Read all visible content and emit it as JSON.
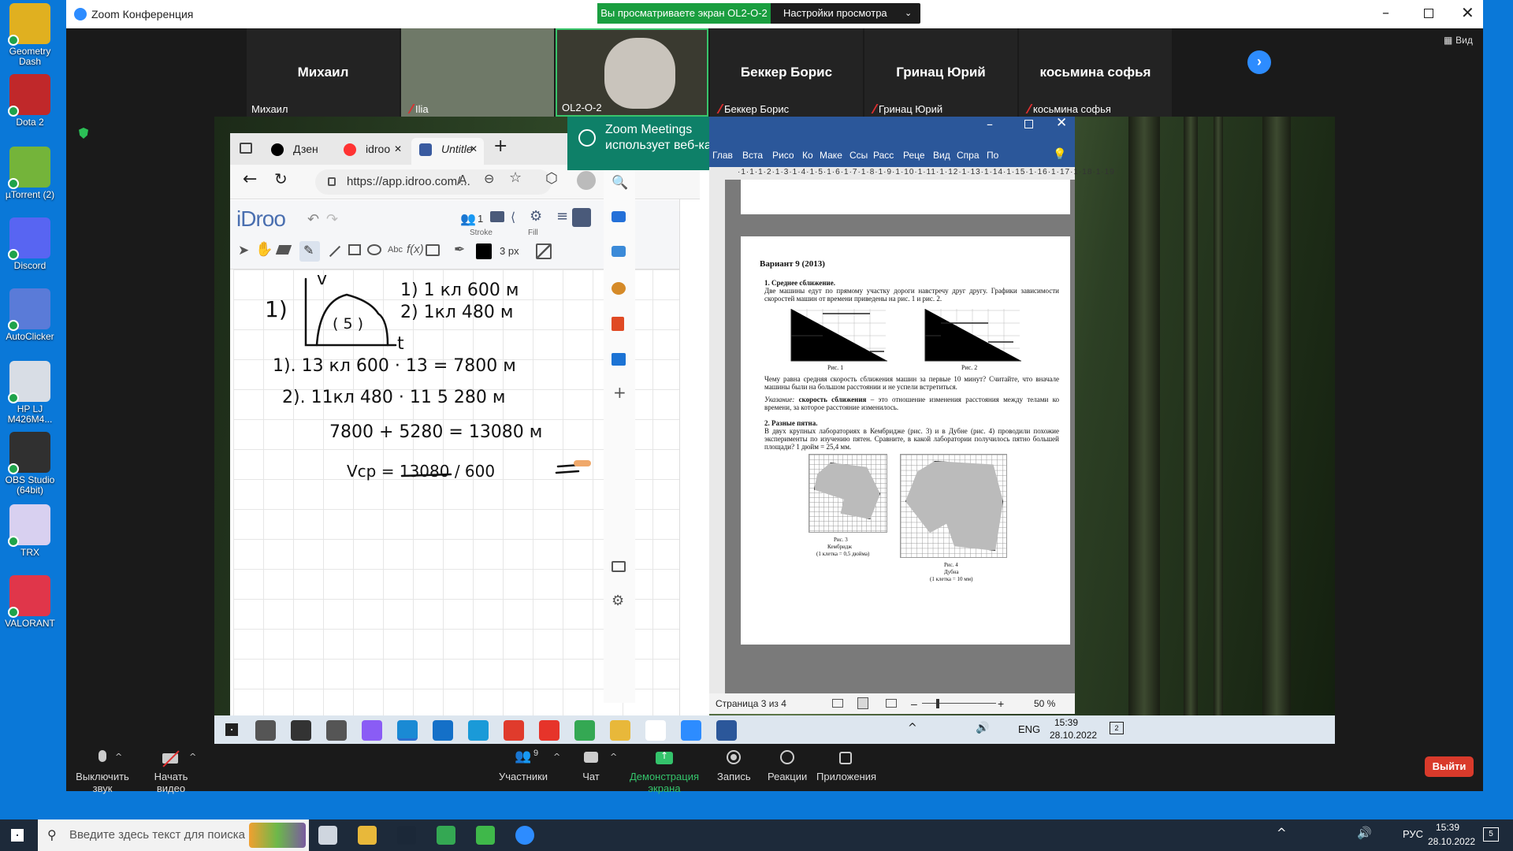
{
  "desktop_icons": [
    {
      "label": "Geometry Dash",
      "icon": "geometry-dash-icon",
      "color": "#e0b020"
    },
    {
      "label": "Dota 2",
      "icon": "dota2-icon",
      "color": "#c0282a"
    },
    {
      "label": "µTorrent (2)",
      "icon": "utorrent-icon",
      "color": "#74b43a"
    },
    {
      "label": "Discord",
      "icon": "discord-icon",
      "color": "#5865f2"
    },
    {
      "label": "AutoClicker",
      "icon": "mouse-icon",
      "color": "#5a7bd8"
    },
    {
      "label": "HP LJ M426M4...",
      "icon": "printer-icon",
      "color": "#d8dde5"
    },
    {
      "label": "OBS Studio (64bit)",
      "icon": "obs-icon",
      "color": "#303030"
    },
    {
      "label": "TRX",
      "icon": "trx-icon",
      "color": "#d8d0f0"
    },
    {
      "label": "VALORANT",
      "icon": "valorant-icon",
      "color": "#e0364a"
    }
  ],
  "zoom": {
    "title": "Zoom Конференция",
    "share_banner": "Вы просматриваете экран OL2-O-2",
    "view_settings": "Настройки просмотра",
    "view_label": "Вид",
    "participants": [
      {
        "big": "Михаил",
        "small": "Михаил",
        "muted": false
      },
      {
        "big": "",
        "small": "Ilia",
        "muted": true
      },
      {
        "big": "",
        "small": "OL2-O-2",
        "muted": false
      },
      {
        "big": "Беккер Борис",
        "small": "Беккер Борис",
        "muted": true
      },
      {
        "big": "Гринац Юрий",
        "small": "Гринац Юрий",
        "muted": true
      },
      {
        "big": "косьмина софья",
        "small": "косьмина софья",
        "muted": true
      }
    ],
    "controls": {
      "mute": "Выключить звук",
      "video": "Начать видео",
      "participants": "Участники",
      "participants_count": "9",
      "chat": "Чат",
      "share": "Демонстрация экрана",
      "record": "Запись",
      "reactions": "Реакции",
      "apps": "Приложения",
      "leave": "Выйти"
    }
  },
  "browser": {
    "tabs": [
      "Дзен",
      "idroo",
      "Untitle"
    ],
    "url": "https://app.idroo.com/...",
    "idroo": {
      "logo": "iDroo",
      "users_count": "1",
      "stroke_label": "Stroke",
      "fill_label": "Fill",
      "stroke_size": "3 px"
    }
  },
  "whiteboard": {
    "lines": [
      "1)",
      "1) 1 кл   600 м",
      "2) 1кл   480 м",
      "1).  13 кл    600 · 13 = 7800 м",
      "2).  11кл    480 · 11    5 280 м",
      "7800 + 5280 = 13080 м",
      "Vср = 13080 / 600"
    ],
    "axis_v": "v",
    "axis_t": "t",
    "graph_label": "( 5 )"
  },
  "notification": {
    "title": "Zoom Meetings",
    "text": "использует веб-камеру"
  },
  "word": {
    "ribbon_tabs": [
      "Глав",
      "Вста",
      "Рисо",
      "Ко",
      "Маке",
      "Ссы",
      "Расс",
      "Реце",
      "Вид",
      "Спра",
      "По"
    ],
    "variant": "Вариант 9 (2013)",
    "p1_title": "1. Среднее сближение.",
    "p1_text": "Две машины едут по прямому участку дороги навстречу друг другу. Графики зависимости скоростей машин от времени приведены на рис. 1 и рис. 2.",
    "fig1": "Рис. 1",
    "fig2": "Рис. 2",
    "question": "Чему равна средняя скорость сближения машин за первые 10 минут? Считайте, что вначале машины были на большом расстоянии и не успели встретиться.",
    "hint_label": "Указание:",
    "hint_bold": "скорость сближения",
    "hint_text": "– это отношение изменения расстояния между телами ко времени, за которое расстояние изменилось.",
    "p2_title": "2. Разные пятна.",
    "p2_text": "В двух крупных лабораториях в Кембридже (рис. 3) и в Дубне (рис. 4) проводили похожие эксперименты по изучению пятен. Сравните, в какой лаборатории получилось пятно большей площади? 1 дюйм = 25,4 мм.",
    "fig3": "Рис. 3",
    "fig3_place": "Кембридж",
    "fig3_scale": "(1 клетка = 0,5 дюйма)",
    "fig4": "Рис. 4",
    "fig4_place": "Дубна",
    "fig4_scale": "(1 клетка = 10 мм)",
    "status_page": "Страница 3 из 4",
    "zoom_pct": "50 %"
  },
  "inner_taskbar": {
    "lang": "ENG",
    "time": "15:39",
    "date": "28.10.2022",
    "notif_count": "2"
  },
  "taskbar": {
    "search_placeholder": "Введите здесь текст для поиска",
    "lang": "РУС",
    "time": "15:39",
    "date": "28.10.2022",
    "notif_count": "5"
  }
}
